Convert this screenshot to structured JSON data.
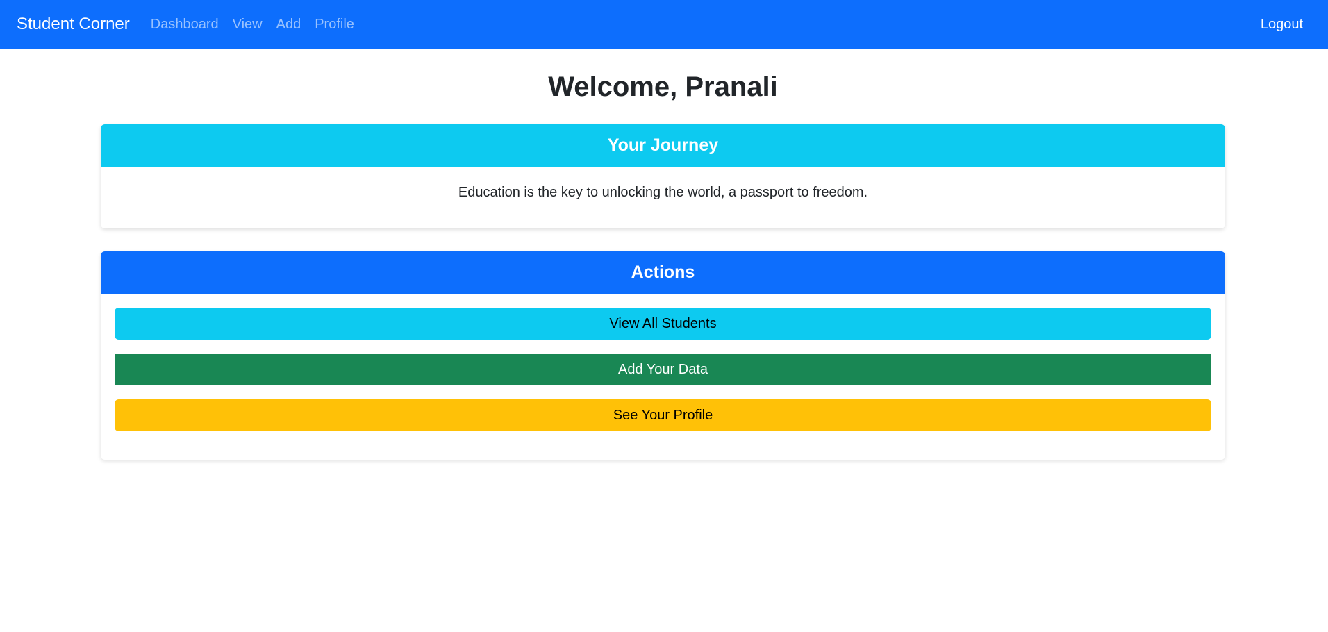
{
  "navbar": {
    "brand": "Student Corner",
    "links": [
      {
        "label": "Dashboard"
      },
      {
        "label": "View"
      },
      {
        "label": "Add"
      },
      {
        "label": "Profile"
      }
    ],
    "logout_label": "Logout"
  },
  "main": {
    "title": "Welcome, Pranali",
    "journey": {
      "header": "Your Journey",
      "quote": "Education is the key to unlocking the world, a passport to freedom."
    },
    "actions": {
      "header": "Actions",
      "buttons": [
        {
          "label": "View All Students",
          "color": "#0dcaf0"
        },
        {
          "label": "Add Your Data",
          "color": "#198754"
        },
        {
          "label": "See Your Profile",
          "color": "#ffc107"
        }
      ]
    }
  },
  "colors": {
    "primary": "#0d6efd",
    "info": "#0dcaf0",
    "success": "#198754",
    "warning": "#ffc107"
  }
}
